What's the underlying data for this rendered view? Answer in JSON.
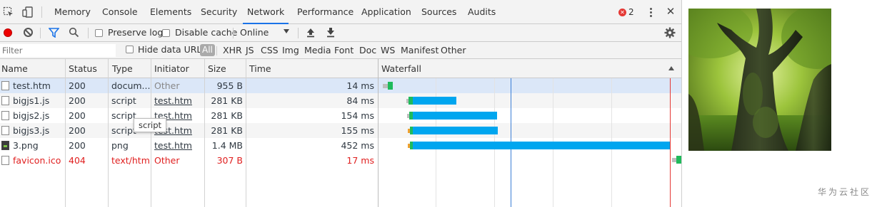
{
  "tabs": [
    "Memory",
    "Console",
    "Elements",
    "Security",
    "Network",
    "Performance",
    "Application",
    "Sources",
    "Audits"
  ],
  "active_tab": "Network",
  "error_count": "2",
  "toolbar": {
    "preserve_log": "Preserve log",
    "disable_cache": "Disable cache",
    "throttling": "Online"
  },
  "filter": {
    "placeholder": "Filter",
    "hide_data_urls": "Hide data URLs",
    "types": [
      "All",
      "XHR",
      "JS",
      "CSS",
      "Img",
      "Media",
      "Font",
      "Doc",
      "WS",
      "Manifest",
      "Other"
    ]
  },
  "columns": [
    "Name",
    "Status",
    "Type",
    "Initiator",
    "Size",
    "Time",
    "Waterfall"
  ],
  "rows": [
    {
      "name": "test.htm",
      "status": "200",
      "type": "docum...",
      "initiator": "Other",
      "size": "955 B",
      "time": "14 ms"
    },
    {
      "name": "bigjs1.js",
      "status": "200",
      "type": "script",
      "initiator": "test.htm",
      "size": "281 KB",
      "time": "84 ms"
    },
    {
      "name": "bigjs2.js",
      "status": "200",
      "type": "script",
      "initiator": "test.htm",
      "size": "281 KB",
      "time": "154 ms"
    },
    {
      "name": "bigjs3.js",
      "status": "200",
      "type": "script",
      "initiator": "test.htm",
      "size": "281 KB",
      "time": "155 ms"
    },
    {
      "name": "3.png",
      "status": "200",
      "type": "png",
      "initiator": "test.htm",
      "size": "1.4 MB",
      "time": "452 ms"
    },
    {
      "name": "favicon.ico",
      "status": "404",
      "type": "text/html",
      "initiator": "Other",
      "size": "307 B",
      "time": "17 ms"
    }
  ],
  "tooltip": "script",
  "watermark": "华为云社区",
  "colors": {
    "waiting_bar": "#00a6ef",
    "ttfb_bar": "#1fba5b",
    "error_text": "#e02020",
    "dom_content_loaded_line": "#3c7fd6",
    "load_line": "#e53935"
  }
}
